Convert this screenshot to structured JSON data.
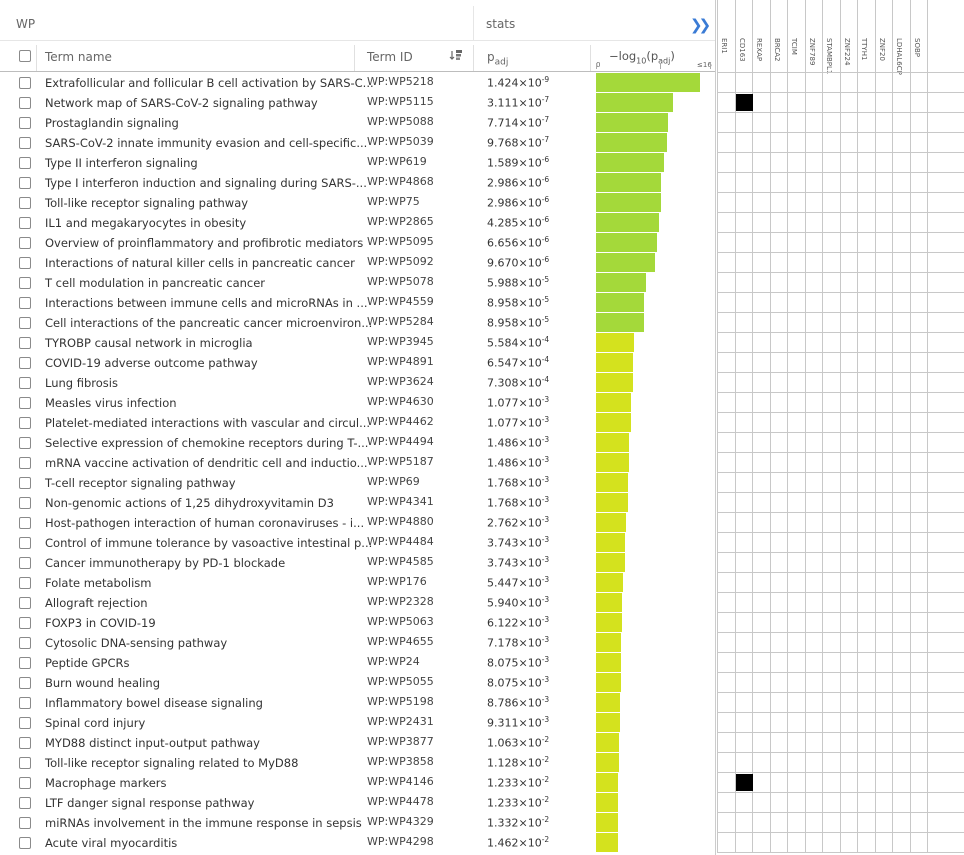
{
  "group_header": {
    "source": "WP",
    "stats": "stats",
    "expand_glyph": "❯❯"
  },
  "columns": {
    "term_name": "Term name",
    "term_id": "Term ID",
    "padj": "p",
    "padj_sub": "adj",
    "log_label_prefix": "−log",
    "log_label_base": "10",
    "log_label_suffix": "(p",
    "log_label_sub": "adj",
    "log_label_end": ")",
    "scale_min": "0",
    "scale_max": "≤16"
  },
  "colors": {
    "bar_green": "#a4d93a",
    "bar_yellow": "#d4e21e",
    "hit": "#000000"
  },
  "genes": [
    "ERI1",
    "CD163",
    "REXAP",
    "BRCA2",
    "TCIM",
    "ZNF789",
    "STAMBPL1",
    "ZNF224",
    "TTYH1",
    "ZNF20",
    "LDHAL6CP",
    "SOBP"
  ],
  "terms": [
    {
      "name": "Extrafollicular and follicular B cell activation by SARS-C...",
      "id": "WP:WP5218",
      "p_mant": "1.424",
      "p_exp": "-9",
      "neglog": 8.85
    },
    {
      "name": "Network map of SARS-CoV-2 signaling pathway",
      "id": "WP:WP5115",
      "p_mant": "3.111",
      "p_exp": "-7",
      "neglog": 6.51
    },
    {
      "name": "Prostaglandin signaling",
      "id": "WP:WP5088",
      "p_mant": "7.714",
      "p_exp": "-7",
      "neglog": 6.11
    },
    {
      "name": "SARS-CoV-2 innate immunity evasion and cell-specific...",
      "id": "WP:WP5039",
      "p_mant": "9.768",
      "p_exp": "-7",
      "neglog": 6.01
    },
    {
      "name": "Type II interferon signaling",
      "id": "WP:WP619",
      "p_mant": "1.589",
      "p_exp": "-6",
      "neglog": 5.8
    },
    {
      "name": "Type I interferon induction and signaling during SARS-...",
      "id": "WP:WP4868",
      "p_mant": "2.986",
      "p_exp": "-6",
      "neglog": 5.52
    },
    {
      "name": "Toll-like receptor signaling pathway",
      "id": "WP:WP75",
      "p_mant": "2.986",
      "p_exp": "-6",
      "neglog": 5.52
    },
    {
      "name": "IL1 and megakaryocytes in obesity",
      "id": "WP:WP2865",
      "p_mant": "4.285",
      "p_exp": "-6",
      "neglog": 5.37
    },
    {
      "name": "Overview of proinflammatory and profibrotic mediators",
      "id": "WP:WP5095",
      "p_mant": "6.656",
      "p_exp": "-6",
      "neglog": 5.18
    },
    {
      "name": "Interactions of natural killer cells in pancreatic cancer",
      "id": "WP:WP5092",
      "p_mant": "9.670",
      "p_exp": "-6",
      "neglog": 5.01
    },
    {
      "name": "T cell modulation in pancreatic cancer",
      "id": "WP:WP5078",
      "p_mant": "5.988",
      "p_exp": "-5",
      "neglog": 4.22
    },
    {
      "name": "Interactions between immune cells and microRNAs in ...",
      "id": "WP:WP4559",
      "p_mant": "8.958",
      "p_exp": "-5",
      "neglog": 4.05
    },
    {
      "name": "Cell interactions of the pancreatic cancer microenviron...",
      "id": "WP:WP5284",
      "p_mant": "8.958",
      "p_exp": "-5",
      "neglog": 4.05
    },
    {
      "name": "TYROBP causal network in microglia",
      "id": "WP:WP3945",
      "p_mant": "5.584",
      "p_exp": "-4",
      "neglog": 3.25
    },
    {
      "name": "COVID-19 adverse outcome pathway",
      "id": "WP:WP4891",
      "p_mant": "6.547",
      "p_exp": "-4",
      "neglog": 3.18
    },
    {
      "name": "Lung fibrosis",
      "id": "WP:WP3624",
      "p_mant": "7.308",
      "p_exp": "-4",
      "neglog": 3.14
    },
    {
      "name": "Measles virus infection",
      "id": "WP:WP4630",
      "p_mant": "1.077",
      "p_exp": "-3",
      "neglog": 2.97
    },
    {
      "name": "Platelet-mediated interactions with vascular and circul...",
      "id": "WP:WP4462",
      "p_mant": "1.077",
      "p_exp": "-3",
      "neglog": 2.97
    },
    {
      "name": "Selective expression of chemokine receptors during T-...",
      "id": "WP:WP4494",
      "p_mant": "1.486",
      "p_exp": "-3",
      "neglog": 2.83
    },
    {
      "name": "mRNA vaccine activation of dendritic cell and inductio...",
      "id": "WP:WP5187",
      "p_mant": "1.486",
      "p_exp": "-3",
      "neglog": 2.83
    },
    {
      "name": "T-cell receptor signaling pathway",
      "id": "WP:WP69",
      "p_mant": "1.768",
      "p_exp": "-3",
      "neglog": 2.75
    },
    {
      "name": "Non-genomic actions of 1,25 dihydroxyvitamin D3",
      "id": "WP:WP4341",
      "p_mant": "1.768",
      "p_exp": "-3",
      "neglog": 2.75
    },
    {
      "name": "Host-pathogen interaction of human coronaviruses - i...",
      "id": "WP:WP4880",
      "p_mant": "2.762",
      "p_exp": "-3",
      "neglog": 2.56
    },
    {
      "name": "Control of immune tolerance by vasoactive intestinal p...",
      "id": "WP:WP4484",
      "p_mant": "3.743",
      "p_exp": "-3",
      "neglog": 2.43
    },
    {
      "name": "Cancer immunotherapy by PD-1 blockade",
      "id": "WP:WP4585",
      "p_mant": "3.743",
      "p_exp": "-3",
      "neglog": 2.43
    },
    {
      "name": "Folate metabolism",
      "id": "WP:WP176",
      "p_mant": "5.447",
      "p_exp": "-3",
      "neglog": 2.26
    },
    {
      "name": "Allograft rejection",
      "id": "WP:WP2328",
      "p_mant": "5.940",
      "p_exp": "-3",
      "neglog": 2.23
    },
    {
      "name": "FOXP3 in COVID-19",
      "id": "WP:WP5063",
      "p_mant": "6.122",
      "p_exp": "-3",
      "neglog": 2.21
    },
    {
      "name": "Cytosolic DNA-sensing pathway",
      "id": "WP:WP4655",
      "p_mant": "7.178",
      "p_exp": "-3",
      "neglog": 2.14
    },
    {
      "name": "Peptide GPCRs",
      "id": "WP:WP24",
      "p_mant": "8.075",
      "p_exp": "-3",
      "neglog": 2.09
    },
    {
      "name": "Burn wound healing",
      "id": "WP:WP5055",
      "p_mant": "8.075",
      "p_exp": "-3",
      "neglog": 2.09
    },
    {
      "name": "Inflammatory bowel disease signaling",
      "id": "WP:WP5198",
      "p_mant": "8.786",
      "p_exp": "-3",
      "neglog": 2.06
    },
    {
      "name": "Spinal cord injury",
      "id": "WP:WP2431",
      "p_mant": "9.311",
      "p_exp": "-3",
      "neglog": 2.03
    },
    {
      "name": "MYD88 distinct input-output pathway",
      "id": "WP:WP3877",
      "p_mant": "1.063",
      "p_exp": "-2",
      "neglog": 1.97
    },
    {
      "name": "Toll-like receptor signaling related to MyD88",
      "id": "WP:WP3858",
      "p_mant": "1.128",
      "p_exp": "-2",
      "neglog": 1.95
    },
    {
      "name": "Macrophage markers",
      "id": "WP:WP4146",
      "p_mant": "1.233",
      "p_exp": "-2",
      "neglog": 1.91
    },
    {
      "name": "LTF danger signal response pathway",
      "id": "WP:WP4478",
      "p_mant": "1.233",
      "p_exp": "-2",
      "neglog": 1.91
    },
    {
      "name": "miRNAs involvement in the immune response in sepsis",
      "id": "WP:WP4329",
      "p_mant": "1.332",
      "p_exp": "-2",
      "neglog": 1.88
    },
    {
      "name": "Acute viral myocarditis",
      "id": "WP:WP4298",
      "p_mant": "1.462",
      "p_exp": "-2",
      "neglog": 1.84
    }
  ],
  "hits": [
    {
      "row": 1,
      "gene": "CD163"
    },
    {
      "row": 35,
      "gene": "CD163"
    }
  ]
}
